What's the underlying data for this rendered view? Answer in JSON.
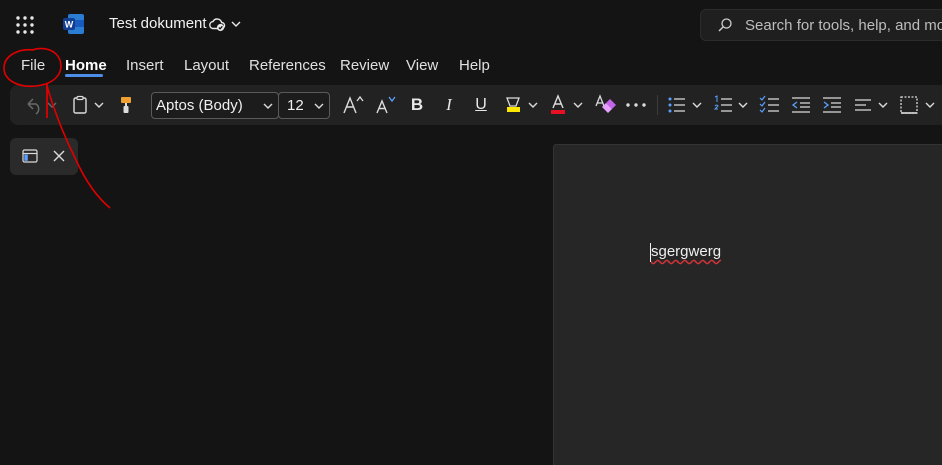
{
  "app": {
    "name": "Word",
    "brand_color": "#185abd"
  },
  "titlebar": {
    "doc_title": "Test dokument",
    "icons": [
      "app-launcher-icon",
      "word-logo-icon",
      "cloud-sync-icon",
      "chevron-down-icon"
    ]
  },
  "search": {
    "placeholder": "Search for tools, help, and more"
  },
  "tabs": [
    {
      "label": "File"
    },
    {
      "label": "Home",
      "active": true
    },
    {
      "label": "Insert"
    },
    {
      "label": "Layout"
    },
    {
      "label": "References"
    },
    {
      "label": "Review"
    },
    {
      "label": "View"
    },
    {
      "label": "Help"
    }
  ],
  "ribbon": {
    "font_name": "Aptos (Body)",
    "font_size": "12",
    "bold_label": "B",
    "italic_label": "I",
    "underline_label": "U",
    "font_color": "#e81123",
    "highlight_color": "#ffe800"
  },
  "document": {
    "text": "sgergwerg"
  },
  "annotation": {
    "color": "#e00000"
  }
}
